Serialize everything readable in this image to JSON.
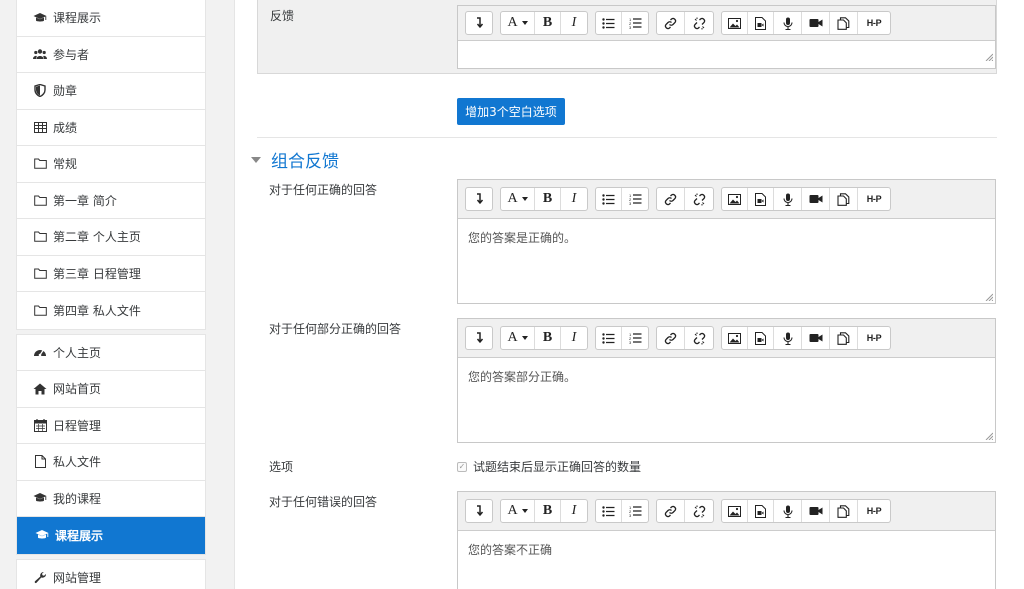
{
  "sidebar": {
    "group1": [
      {
        "label": "课程展示",
        "icon": "graduation-cap-icon"
      },
      {
        "label": "参与者",
        "icon": "users-icon"
      },
      {
        "label": "勋章",
        "icon": "shield-icon"
      },
      {
        "label": "成绩",
        "icon": "table-icon"
      },
      {
        "label": "常规",
        "icon": "folder-icon"
      },
      {
        "label": "第一章 简介",
        "icon": "folder-icon"
      },
      {
        "label": "第二章 个人主页",
        "icon": "folder-icon"
      },
      {
        "label": "第三章 日程管理",
        "icon": "folder-icon"
      },
      {
        "label": "第四章 私人文件",
        "icon": "folder-icon"
      }
    ],
    "group2": [
      {
        "label": "个人主页",
        "icon": "dashboard-icon"
      },
      {
        "label": "网站首页",
        "icon": "home-icon"
      },
      {
        "label": "日程管理",
        "icon": "calendar-icon"
      },
      {
        "label": "私人文件",
        "icon": "file-icon"
      },
      {
        "label": "我的课程",
        "icon": "graduation-cap-icon"
      },
      {
        "label": "课程展示",
        "icon": "graduation-cap-icon",
        "active": true
      }
    ],
    "group3": [
      {
        "label": "网站管理",
        "icon": "wrench-icon"
      }
    ]
  },
  "main": {
    "feedback_label": "反馈",
    "add_button_label": "增加3个空白选项",
    "section_title": "组合反馈",
    "correct_label": "对于任何正确的回答",
    "correct_text": "您的答案是正确的。",
    "partial_label": "对于任何部分正确的回答",
    "partial_text": "您的答案部分正确。",
    "options_label": "选项",
    "options_checkbox_label": "试题结束后显示正确回答的数量",
    "incorrect_label": "对于任何错误的回答",
    "incorrect_text": "您的答案不正确"
  },
  "toolbar": {
    "font_label": "A",
    "bold_label": "B",
    "italic_label": "I",
    "h5p_label": "H-P"
  },
  "colors": {
    "accent": "#1177d1",
    "border": "#c8c8c8",
    "toolbar_bg": "#f0f0f0"
  }
}
